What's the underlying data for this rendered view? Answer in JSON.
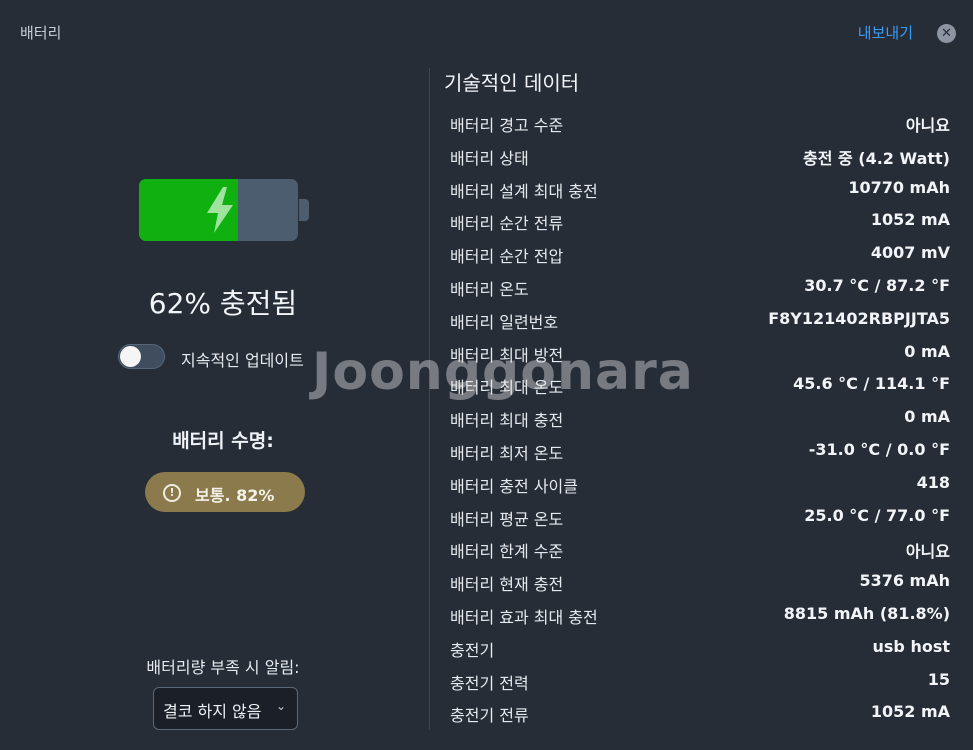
{
  "header": {
    "title": "배터리",
    "export_label": "내보내기",
    "close_symbol": "✕"
  },
  "battery": {
    "level_fraction": 0.62,
    "charge_text": "62% 충전됨",
    "fill_color": "#0fb00f",
    "empty_color": "#4c5d70"
  },
  "toggle": {
    "label": "지속적인 업데이트",
    "on": false
  },
  "health": {
    "title": "배터리 수명:",
    "badge_text": "보통. 82%",
    "badge_icon": "!",
    "badge_color": "#8a7a4c"
  },
  "alert": {
    "label": "배터리량 부족 시 알림:",
    "selected": "결코 하지 않음"
  },
  "tech": {
    "title": "기술적인 데이터",
    "rows": [
      {
        "key": "배터리 경고 수준",
        "value": "아니요"
      },
      {
        "key": "배터리 상태",
        "value": "충전 중 (4.2 Watt)"
      },
      {
        "key": "배터리 설계 최대 충전",
        "value": "10770 mAh"
      },
      {
        "key": "배터리 순간 전류",
        "value": "1052 mA"
      },
      {
        "key": "배터리 순간 전압",
        "value": "4007 mV"
      },
      {
        "key": "배터리 온도",
        "value": "30.7 °C / 87.2 °F"
      },
      {
        "key": "배터리 일련번호",
        "value": "F8Y121402RBPJJTA5"
      },
      {
        "key": "배터리 최대 방전",
        "value": "0 mA"
      },
      {
        "key": "배터리 최대 온도",
        "value": "45.6 °C / 114.1 °F"
      },
      {
        "key": "배터리 최대 충전",
        "value": "0 mA"
      },
      {
        "key": "배터리 최저 온도",
        "value": "-31.0 °C / 0.0 °F"
      },
      {
        "key": "배터리 충전 사이클",
        "value": "418"
      },
      {
        "key": "배터리 평균 온도",
        "value": "25.0 °C / 77.0 °F"
      },
      {
        "key": "배터리 한계 수준",
        "value": "아니요"
      },
      {
        "key": "배터리 현재 충전",
        "value": "5376 mAh"
      },
      {
        "key": "배터리 효과 최대 충전",
        "value": "8815 mAh (81.8%)"
      },
      {
        "key": "충전기",
        "value": "usb host"
      },
      {
        "key": "충전기 전력",
        "value": "15"
      },
      {
        "key": "충전기 전류",
        "value": "1052 mA"
      }
    ]
  },
  "watermark": "Joonggonara",
  "colors": {
    "background": "#262d37",
    "accent": "#3d9af5"
  }
}
